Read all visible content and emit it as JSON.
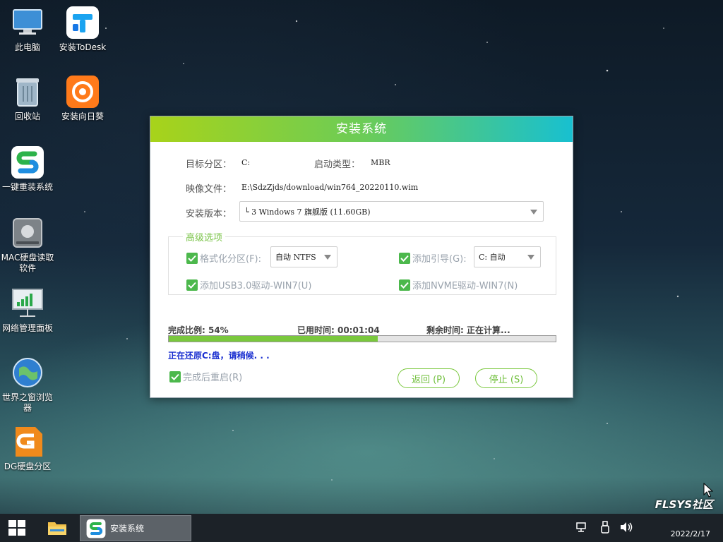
{
  "desktop": {
    "icons": [
      {
        "label": "此电脑"
      },
      {
        "label": "安装ToDesk"
      },
      {
        "label": "回收站"
      },
      {
        "label": "安装向日葵"
      },
      {
        "label": "一键重装系统"
      },
      {
        "label": "MAC硬盘读取软件"
      },
      {
        "label": "网络管理面板"
      },
      {
        "label": "世界之窗浏览器"
      },
      {
        "label": "DG硬盘分区"
      }
    ]
  },
  "dialog": {
    "title": "安装系统",
    "target_partition_label": "目标分区：",
    "target_partition_value": "C:",
    "boot_type_label": "启动类型：",
    "boot_type_value": "MBR",
    "image_file_label": "映像文件：",
    "image_file_value": "E:\\SdzZjds/download/win764_20220110.wim",
    "install_version_label": "安装版本：",
    "install_version_value": "└ 3 Windows 7 旗舰版 (11.60GB)",
    "advanced_title": "高级选项",
    "format_partition_label": "格式化分区(F):",
    "format_partition_value": "自动 NTFS",
    "add_boot_label": "添加引导(G):",
    "add_boot_value": "C: 自动",
    "usb3_label": "添加USB3.0驱动-WIN7(U)",
    "nvme_label": "添加NVME驱动-WIN7(N)",
    "progress_text": "完成比例: 54%",
    "progress_fraction": 0.54,
    "elapsed_text": "已用时间: 00:01:04",
    "remaining_text": "剩余时间: 正在计算...",
    "status_text": "正在还原C:盘，请稍候. . .",
    "restart_label": "完成后重启(R)",
    "back_button": "返回 (P)",
    "stop_button": "停止 (S)"
  },
  "taskbar": {
    "active_task_label": "安装系统",
    "clock_date": "2022/2/17",
    "watermark": "FLSYS社区"
  },
  "colors": {
    "accent_green": "#7ac83d",
    "header_start": "#a8d31a",
    "header_end": "#18c0d0",
    "status_blue": "#1a2fd0"
  }
}
